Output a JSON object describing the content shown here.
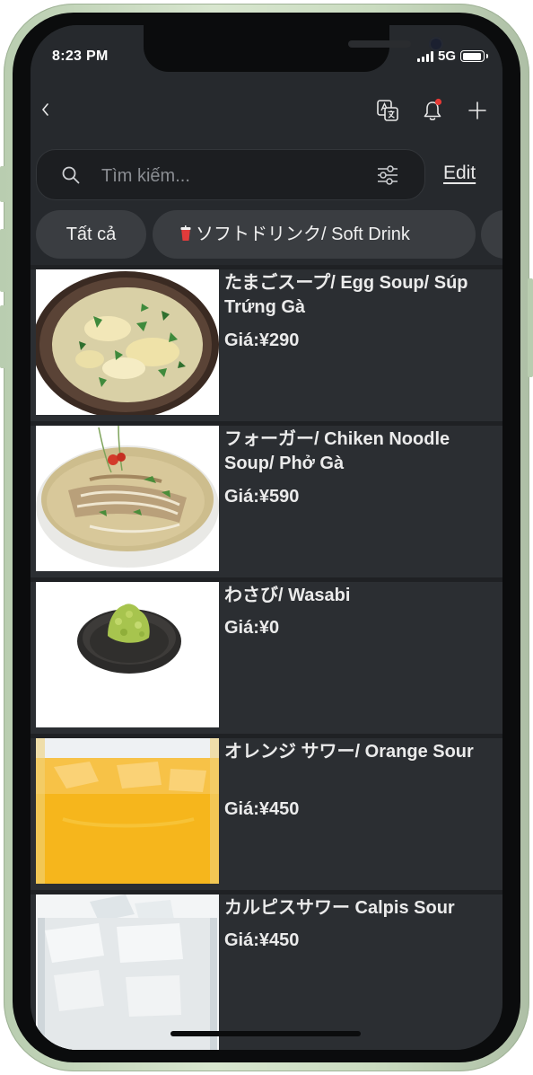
{
  "status_bar": {
    "time": "8:23 PM",
    "network": "5G",
    "battery_level": 0.95
  },
  "navbar": {
    "back_icon": "chevron-left-icon",
    "translate_icon": "translate-icon",
    "notification_icon": "bell-icon",
    "notification_dot_color": "#e53935",
    "add_icon": "plus-icon"
  },
  "search": {
    "placeholder": "Tìm kiếm...",
    "value": "",
    "filter_icon": "filter-sliders-icon",
    "edit_label": "Edit"
  },
  "tabs": [
    {
      "label": "Tất cả"
    },
    {
      "label": "ソフトドリンク/ Soft Drink",
      "icon": "cup-icon"
    }
  ],
  "menu_items": [
    {
      "name": "たまごスープ/ Egg Soup/ Súp Trứng Gà",
      "price": "Giá:¥290",
      "image": "egg-soup-photo"
    },
    {
      "name": "フォーガー/ Chiken Noodle Soup/ Phở Gà",
      "price": "Giá:¥590",
      "image": "pho-ga-photo"
    },
    {
      "name": "わさび/ Wasabi",
      "price": "Giá:¥0",
      "image": "wasabi-photo"
    },
    {
      "name": "オレンジ サワー/ Orange Sour",
      "price": "Giá:¥450",
      "image": "orange-sour-photo"
    },
    {
      "name": "カルピスサワー Calpis Sour",
      "price": "Giá:¥450",
      "image": "calpis-sour-photo"
    }
  ],
  "colors": {
    "background": "#1f2124",
    "header": "#26292d",
    "card": "#2b2e32",
    "chip": "#3a3d41",
    "text": "#ebebeb",
    "frame": "#c8dabd"
  }
}
